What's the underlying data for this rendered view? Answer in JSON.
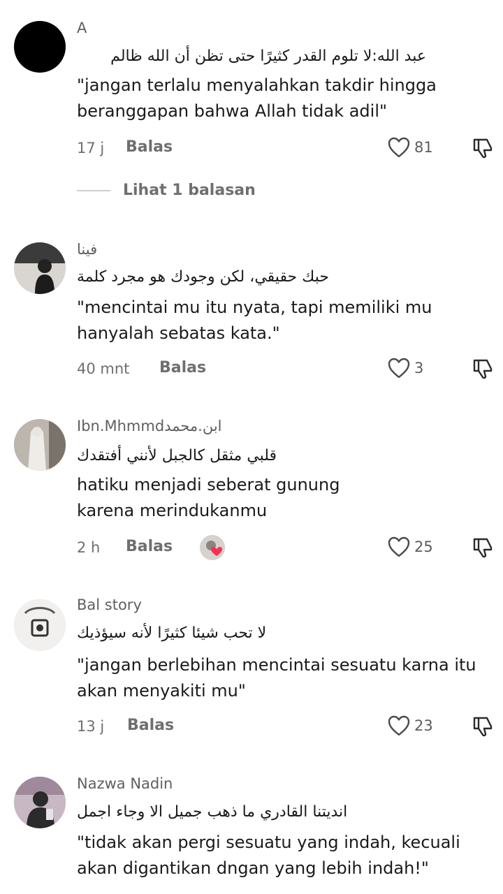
{
  "comments": [
    {
      "username": "A",
      "arabic": "عبد الله:لا تلوم القدر كثيرًا حتى تظن أن الله ظالم",
      "text": "\"jangan terlalu menyalahkan takdir hingga beranggapan bahwa Allah tidak adil\"",
      "time": "17 j",
      "reply": "Balas",
      "likes": "81",
      "view_replies": "Lihat 1 balasan"
    },
    {
      "username": "فينا",
      "arabic": "حبك حقيقي، لكن وجودك هو مجرد كلمة",
      "text": "\"mencintai mu itu nyata, tapi memiliki mu hanyalah sebatas kata.\"",
      "time": "40 mnt",
      "reply": "Balas",
      "likes": "3"
    },
    {
      "username": "Ibn.Mhmmdابن.محمد",
      "arabic": "قلبي مثقل كالجبل لأنني أفتقدك",
      "text": "hatiku menjadi seberat gunung karena merindukanmu",
      "time": "2 h",
      "reply": "Balas",
      "likes": "25"
    },
    {
      "username": "Bal story",
      "arabic": "لا تحب شيئا كثيرًا لأنه سيؤذيك",
      "text": "\"jangan berlebihan mencintai sesuatu karna itu akan menyakiti mu\"",
      "time": "13 j",
      "reply": "Balas",
      "likes": "23"
    },
    {
      "username": "Nazwa Nadin",
      "arabic": "انديتنا القادري ما ذهب جميل الا وجاء اجمل",
      "text": "\"tidak akan pergi sesuatu yang indah, kecuali akan digantikan dngan yang lebih indah!\""
    }
  ],
  "icons": {
    "like": "heart-outline-icon",
    "dislike": "thumbs-down-outline-icon"
  },
  "colors": {
    "text": "#1a1a1a",
    "muted": "#6f6f6f",
    "background": "#ffffff"
  }
}
